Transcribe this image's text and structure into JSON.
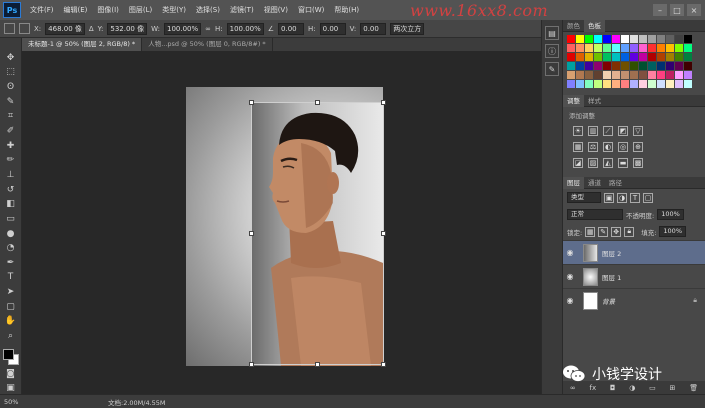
{
  "app": {
    "logo": "Ps"
  },
  "menu": [
    "文件(F)",
    "编辑(E)",
    "图像(I)",
    "图层(L)",
    "类型(Y)",
    "选择(S)",
    "滤镜(T)",
    "视图(V)",
    "窗口(W)",
    "帮助(H)"
  ],
  "watermark": "www.16xx8.com",
  "options": {
    "x_label": "X:",
    "x_value": "468.00 像",
    "y_label": "Y:",
    "y_value": "532.00 像",
    "w_label": "W:",
    "w_value": "100.00%",
    "h_label": "H:",
    "h_value": "100.00%",
    "angle_value": "0.00",
    "hskew_label": "H:",
    "hskew_value": "0.00",
    "vskew_label": "V:",
    "vskew_value": "0.00",
    "interp_value": "两次立方"
  },
  "tabs": [
    {
      "label": "未标题-1 @ 50% (图层 2, RGB/8) *",
      "active": true
    },
    {
      "label": "人物...psd @ 50% (图层 0, RGB/8#) *",
      "active": false
    }
  ],
  "status": {
    "zoom": "50%",
    "doc": "文档:2.00M/4.55M"
  },
  "panels": {
    "swatch_tabs": [
      "颜色",
      "色板"
    ],
    "adjust_tabs": [
      "调整",
      "样式"
    ],
    "adjust_subtitle": "添加调整",
    "layer_tabs": [
      "图层",
      "通道",
      "路径"
    ],
    "kind_label": "类型",
    "blend_mode": "正常",
    "opacity_label": "不透明度:",
    "opacity_value": "100%",
    "lock_label": "锁定:",
    "fill_label": "填充:",
    "fill_value": "100%",
    "layers": [
      {
        "name": "图层 2",
        "active": true,
        "locked": false
      },
      {
        "name": "图层 1",
        "active": false,
        "locked": false
      },
      {
        "name": "背景",
        "active": false,
        "locked": true
      }
    ]
  },
  "badge": {
    "text": "小钱学设计"
  },
  "colors": {
    "swatches": [
      "#ff0000",
      "#ffff00",
      "#00ff00",
      "#00ffff",
      "#0000ff",
      "#ff00ff",
      "#ffffff",
      "#e0e0e0",
      "#c0c0c0",
      "#a0a0a0",
      "#808080",
      "#606060",
      "#404040",
      "#000000",
      "#ff6060",
      "#ff9060",
      "#ffd060",
      "#c0ff60",
      "#60ff90",
      "#60ffff",
      "#60a0ff",
      "#9060ff",
      "#ff60d0",
      "#ff3030",
      "#ff8000",
      "#ffc000",
      "#80ff00",
      "#00ff80",
      "#e00000",
      "#e06000",
      "#e0b000",
      "#70c000",
      "#00c060",
      "#00c0c0",
      "#0060e0",
      "#6000e0",
      "#c000a0",
      "#b00000",
      "#b04000",
      "#a08000",
      "#408000",
      "#008040",
      "#00a0a0",
      "#0040a0",
      "#4000a0",
      "#900070",
      "#800000",
      "#803000",
      "#705000",
      "#305000",
      "#005030",
      "#006060",
      "#003070",
      "#300070",
      "#600050",
      "#400000",
      "#d8a070",
      "#b07850",
      "#886040",
      "#604030",
      "#f0d0b0",
      "#e0b090",
      "#c09070",
      "#a07050",
      "#805040",
      "#ff80a0",
      "#ff4080",
      "#c02060",
      "#ffa0ff",
      "#c080ff",
      "#8080ff",
      "#80c0ff",
      "#80ffc0",
      "#c0ff80",
      "#ffe080",
      "#ffb080",
      "#ff8080",
      "#b0b0ff",
      "#ffd0e0",
      "#d0ffd0",
      "#d0e0ff",
      "#fff0c0",
      "#e0c0ff",
      "#c0ffff"
    ]
  }
}
